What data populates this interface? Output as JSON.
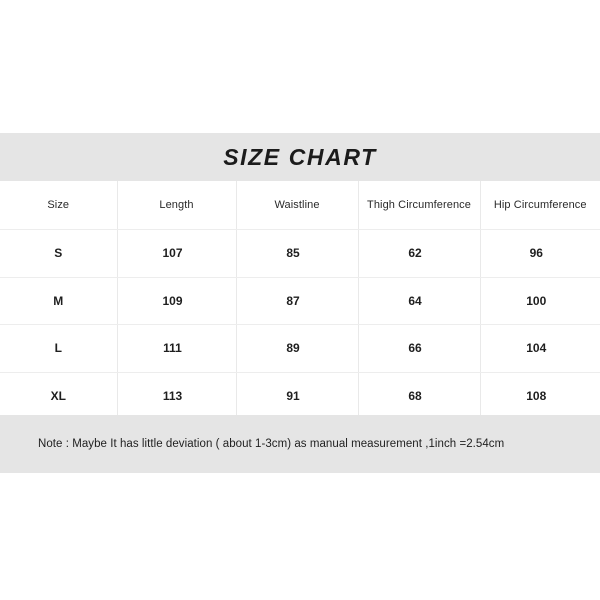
{
  "title": "SIZE CHART",
  "table": {
    "columns": [
      "Size",
      "Length",
      "Waistline",
      "Thigh Circumference",
      "Hip Circumference"
    ],
    "rows": [
      {
        "size": "S",
        "length": "107",
        "waistline": "85",
        "thigh": "62",
        "hip": "96"
      },
      {
        "size": "M",
        "length": "109",
        "waistline": "87",
        "thigh": "64",
        "hip": "100"
      },
      {
        "size": "L",
        "length": "111",
        "waistline": "89",
        "thigh": "66",
        "hip": "104"
      },
      {
        "size": "XL",
        "length": "113",
        "waistline": "91",
        "thigh": "68",
        "hip": "108"
      }
    ]
  },
  "note": "Note : Maybe It has little deviation ( about 1-3cm) as manual measurement ,1inch =2.54cm",
  "colors": {
    "band_background": "#e5e5e5",
    "page_background": "#ffffff",
    "text": "#1f1f1f",
    "grid_line": "#e9e9e9"
  }
}
